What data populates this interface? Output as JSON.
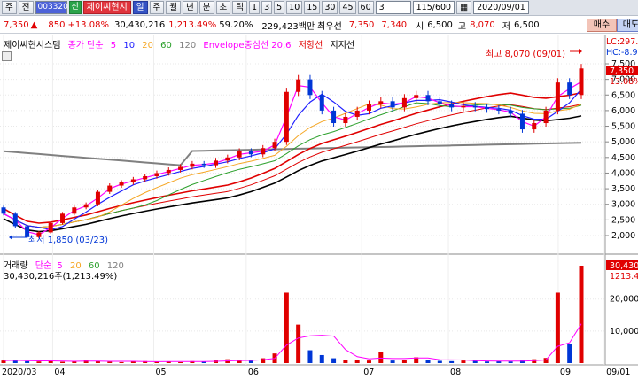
{
  "toolbar": {
    "labels": [
      "주",
      "전",
      "003320",
      "신",
      "제이씨현시",
      "일",
      "주",
      "월",
      "년",
      "분",
      "초",
      "틱"
    ],
    "periods": [
      "1",
      "3",
      "5",
      "10",
      "15",
      "30",
      "45",
      "60"
    ],
    "count_box": "3",
    "page_count": "115/600",
    "date": "2020/09/01"
  },
  "quote": {
    "price": "7,350",
    "change": "850",
    "change_pct": "+13.08%",
    "volume": "30,430,216",
    "volume_pct": "1,213.49%",
    "ratio": "59.20%",
    "amount": "229,423백만",
    "best_sell_label": "최우선",
    "best_sell": "7,350",
    "best_buy": "7,340",
    "open_label": "시",
    "open": "6,500",
    "high_label": "고",
    "high": "8,070",
    "low_label": "저",
    "low": "6,500",
    "buy_button": "매수",
    "sell_button": "매도"
  },
  "legend": {
    "title": "제이씨현시스템",
    "ma_label": "종가 단순",
    "ma_periods": [
      "5",
      "10",
      "20",
      "60",
      "120"
    ],
    "envelope": "Envelope중심선 20,6",
    "resistance": "저항선",
    "support": "지지선",
    "volume_title": "거래량",
    "vol_ma_label": "단순",
    "vol_periods": [
      "5",
      "20",
      "60",
      "120"
    ],
    "volume_value": "30,430,216주(1,213.49%)"
  },
  "annotations": {
    "high": "최고 8,070 (09/01)",
    "low": "최저 1,850 (03/23)"
  },
  "axis": {
    "lc_label": "LC:297.",
    "hc_label": "HC:-8.9",
    "price_ticks": [
      "7,500",
      "7,000",
      "6,500",
      "6,000",
      "5,500",
      "5,000",
      "4,500",
      "4,000",
      "3,500",
      "3,000",
      "2,500",
      "2,000"
    ],
    "current_price": "7,350",
    "current_pct": "13.08%",
    "volume_ticks": [
      "20,000",
      "10,000"
    ],
    "volume_current": "30,430",
    "volume_current_pct": "1213.49",
    "months": [
      "2020/03",
      "04",
      "05",
      "06",
      "07",
      "08",
      "09",
      "09/01"
    ]
  },
  "colors": {
    "up": "#e00000",
    "down": "#0036d6",
    "ma5": "#ff00ff",
    "ma10": "#2020ff",
    "ma20": "#f5a623",
    "ma60": "#2ca02c",
    "ma120": "#808080"
  },
  "chart_data": {
    "type": "candlestick",
    "price_axis": [
      2000,
      7500
    ],
    "high": {
      "value": 8070,
      "date": "09/01"
    },
    "low": {
      "value": 1850,
      "date": "03/23"
    },
    "close": 7350,
    "series_close": [
      2700,
      2300,
      1950,
      2100,
      2400,
      2700,
      2900,
      3000,
      3400,
      3600,
      3700,
      3800,
      3900,
      4000,
      4100,
      4200,
      4300,
      4250,
      4400,
      4500,
      4700,
      4600,
      4800,
      5000,
      6600,
      7000,
      6500,
      6000,
      5600,
      5800,
      6000,
      6200,
      6300,
      6100,
      6400,
      6500,
      6300,
      6200,
      6100,
      6150,
      6100,
      6050,
      6000,
      5900,
      5400,
      5600,
      6000,
      6900,
      6500,
      7350
    ],
    "volume_series": [
      800,
      900,
      600,
      500,
      700,
      400,
      500,
      900,
      600,
      400,
      300,
      500,
      600,
      400,
      500,
      300,
      600,
      500,
      900,
      1200,
      800,
      700,
      1500,
      3000,
      22000,
      12000,
      4000,
      2500,
      1500,
      1000,
      900,
      800,
      3500,
      800,
      1000,
      1800,
      900,
      700,
      600,
      800,
      700,
      500,
      600,
      500,
      900,
      1200,
      1600,
      22000,
      6000,
      30430
    ]
  }
}
